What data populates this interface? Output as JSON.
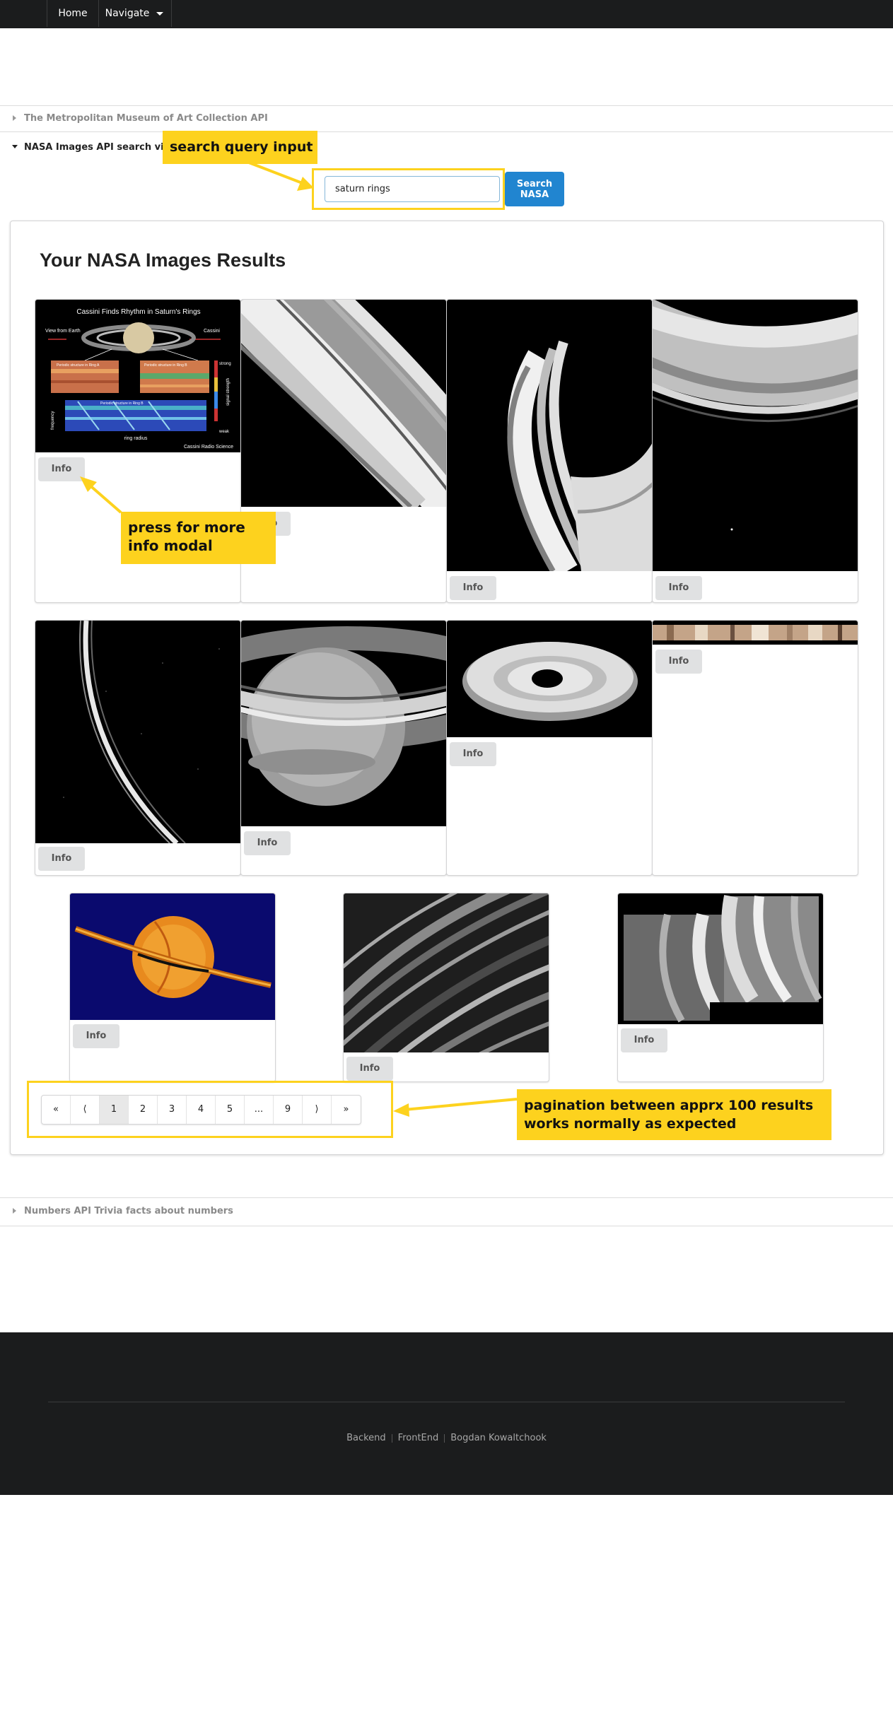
{
  "nav": {
    "home": "Home",
    "navigate": "Navigate"
  },
  "accordion": {
    "met": "The Metropolitan Museum of Art Collection API",
    "nasa": "NASA Images API search view",
    "numbers": "Numbers API Trivia facts about numbers"
  },
  "search": {
    "value": "saturn rings",
    "button_line1": "Search",
    "button_line2": "NASA"
  },
  "results": {
    "title": "Your NASA Images Results",
    "info_label": "Info",
    "first_image": {
      "heading": "Cassini Finds Rhythm in Saturn's Rings",
      "view_from_earth": "View from Earth",
      "cassini": "Cassini",
      "strong": "strong",
      "weak": "weak",
      "signal_strength": "signal strength",
      "frequency": "frequency",
      "ring_radius": "ring radius",
      "credit": "Cassini Radio Science",
      "panel_a": "Periodic structure in Ring A",
      "panel_b": "Periodic structure in Ring B",
      "panel_c": "Periodic structure in Ring B"
    }
  },
  "pagination": {
    "items": [
      "«",
      "⟨",
      "1",
      "2",
      "3",
      "4",
      "5",
      "...",
      "9",
      "⟩",
      "»"
    ],
    "active": "1"
  },
  "callouts": {
    "search": "search query input",
    "info_line1": "press for more",
    "info_line2": "info modal",
    "pager_line1": "pagination between apprx 100 results",
    "pager_line2": "works normally as expected"
  },
  "footer": {
    "backend": "Backend",
    "frontend": "FrontEnd",
    "author": "Bogdan Kowaltchook"
  },
  "colors": {
    "nav_bg": "#1b1c1d",
    "primary": "#2185d0",
    "callout": "#fdd21e"
  }
}
